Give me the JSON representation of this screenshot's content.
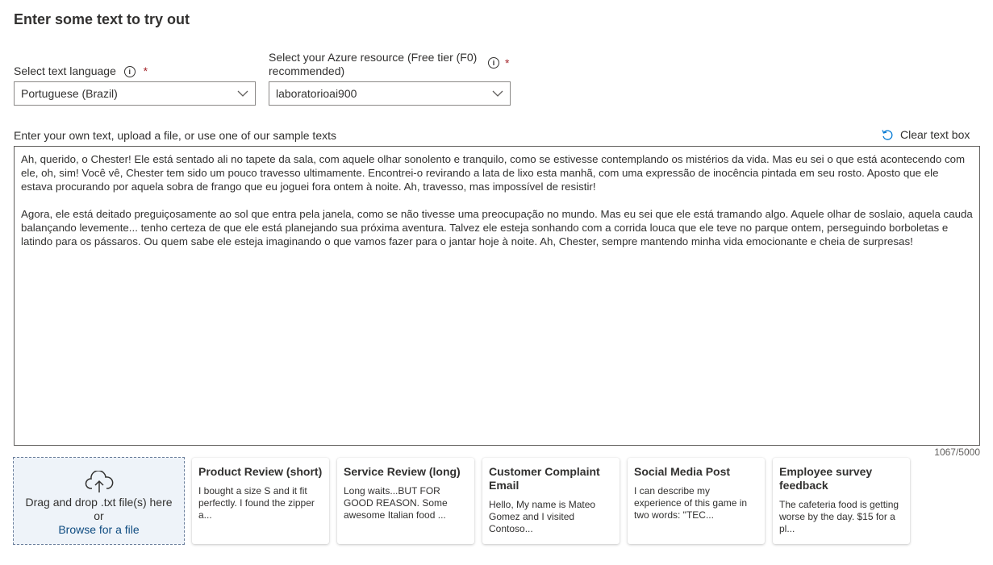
{
  "heading": "Enter some text to try out",
  "language": {
    "label": "Select text language",
    "info_icon": "info-icon",
    "required_mark": "*",
    "value": "Portuguese (Brazil)"
  },
  "resource": {
    "label": "Select your Azure resource (Free tier (F0) recommended)",
    "info_icon": "info-icon",
    "required_mark": "*",
    "value": "laboratorioai900"
  },
  "text_input": {
    "label": "Enter your own text, upload a file, or use one of our sample texts",
    "clear_label": "Clear text box",
    "paragraphs": [
      "Ah, querido, o Chester! Ele está sentado ali no tapete da sala, com aquele olhar sonolento e tranquilo, como se estivesse contemplando os mistérios da vida. Mas eu sei o que está acontecendo com ele, oh, sim! Você vê, Chester tem sido um pouco travesso ultimamente. Encontrei-o revirando a lata de lixo esta manhã, com uma expressão de inocência pintada em seu rosto. Aposto que ele estava procurando por aquela sobra de frango que eu joguei fora ontem à noite. Ah, travesso, mas impossível de resistir!",
      "Agora, ele está deitado preguiçosamente ao sol que entra pela janela, como se não tivesse uma preocupação no mundo. Mas eu sei que ele está tramando algo. Aquele olhar de soslaio, aquela cauda balançando levemente... tenho certeza de que ele está planejando sua próxima aventura. Talvez ele esteja sonhando com a corrida louca que ele teve no parque ontem, perseguindo borboletas e latindo para os pássaros. Ou quem sabe ele esteja imaginando o que vamos fazer para o jantar hoje à noite. Ah, Chester, sempre mantendo minha vida emocionante e cheia de surpresas!"
    ],
    "counter": "1067/5000"
  },
  "upload": {
    "drag_text": "Drag and drop .txt file(s) here",
    "or_text": "or",
    "browse_label": "Browse for a file",
    "icon": "cloud-upload-icon"
  },
  "samples": [
    {
      "title": "Product Review (short)",
      "snippet": "I bought a size S and it fit perfectly. I found the zipper a..."
    },
    {
      "title": "Service Review (long)",
      "snippet": "Long waits...BUT FOR GOOD REASON. Some awesome Italian food ..."
    },
    {
      "title": "Customer Complaint Email",
      "snippet": "Hello, My name is Mateo Gomez and I visited Contoso..."
    },
    {
      "title": "Social Media Post",
      "snippet": "I can describe my experience of this game in two words: \"TEC..."
    },
    {
      "title": "Employee survey feedback",
      "snippet": "The cafeteria food is getting worse by the day. $15 for a pl..."
    }
  ],
  "colors": {
    "required": "#a4262c",
    "link": "#0f4c81",
    "dropzone_bg": "#eef3f9"
  }
}
